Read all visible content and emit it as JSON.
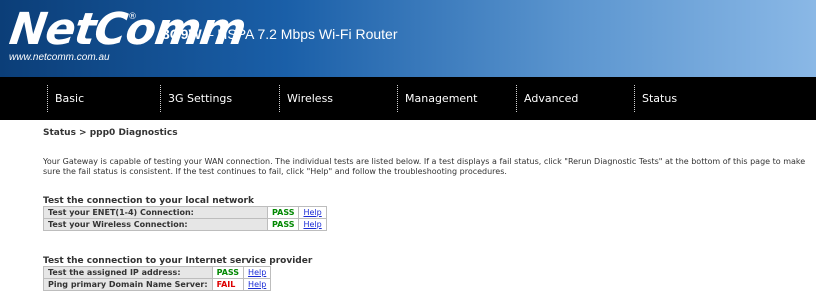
{
  "header": {
    "logo_text": "NetComm",
    "logo_url": "www.netcomm.com.au",
    "product_model": "3G9W",
    "product_desc": " – HSPA 7.2 Mbps Wi-Fi Router"
  },
  "nav": {
    "items": [
      {
        "label": "Basic"
      },
      {
        "label": "3G Settings"
      },
      {
        "label": "Wireless"
      },
      {
        "label": "Management"
      },
      {
        "label": "Advanced"
      },
      {
        "label": "Status"
      }
    ]
  },
  "breadcrumb": "Status > ppp0 Diagnostics",
  "description": "Your Gateway is capable of testing your WAN connection. The individual tests are listed below. If a test displays a fail status, click \"Rerun Diagnostic Tests\" at the bottom of this page to make sure the fail status is consistent. If the test continues to fail, click \"Help\" and follow the troubleshooting procedures.",
  "sections": [
    {
      "title": "Test the connection to your local network",
      "tests": [
        {
          "label": "Test your ENET(1-4) Connection:",
          "result": "PASS",
          "help": "Help"
        },
        {
          "label": "Test your Wireless Connection:",
          "result": "PASS",
          "help": "Help"
        }
      ]
    },
    {
      "title": "Test the connection to your Internet service provider",
      "tests": [
        {
          "label": "Test the assigned IP address:",
          "result": "PASS",
          "help": "Help"
        },
        {
          "label": "Ping primary Domain Name Server:",
          "result": "FAIL",
          "help": "Help"
        }
      ]
    }
  ],
  "colors": {
    "pass": "#008800",
    "fail": "#dd0000",
    "link": "#1a2cd6"
  }
}
